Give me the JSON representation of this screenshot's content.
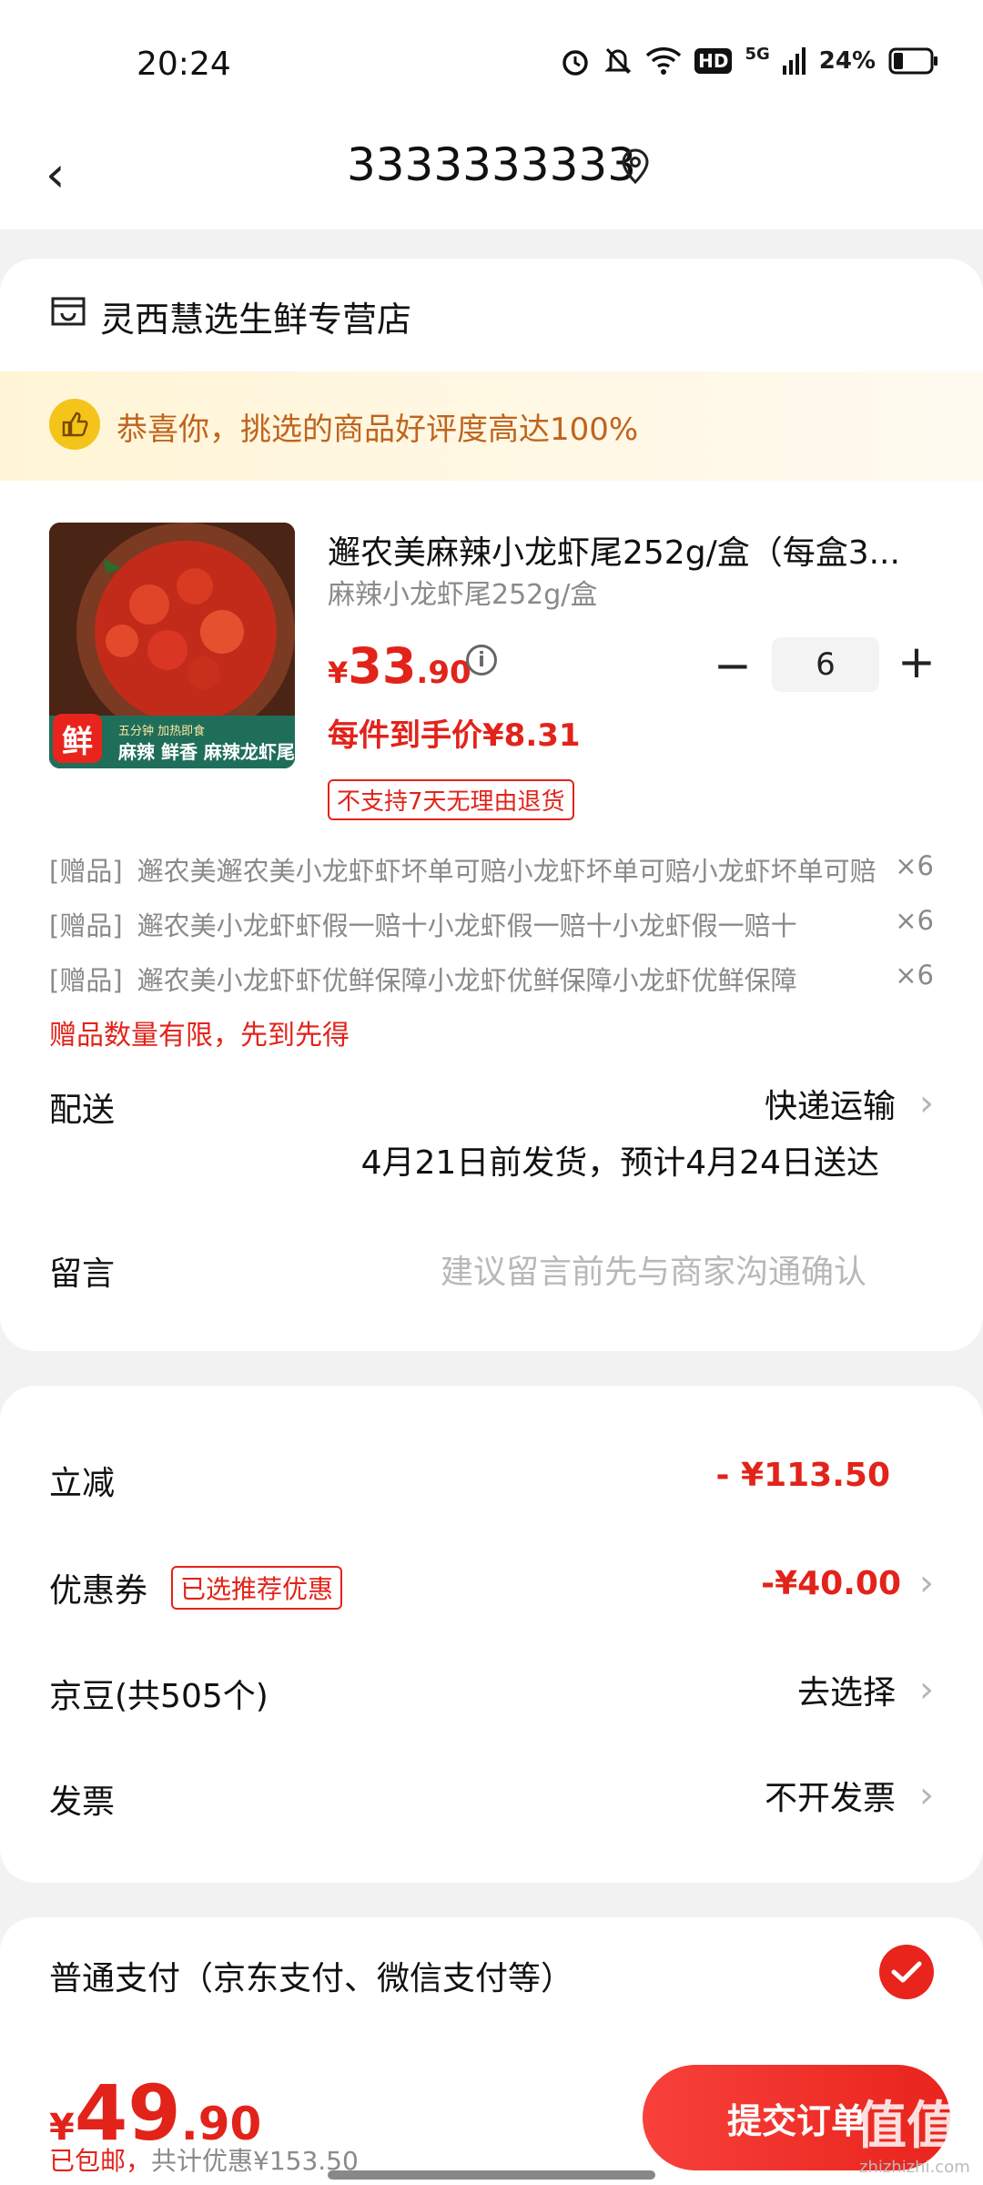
{
  "status_bar": {
    "time": "20:24",
    "network": "5G",
    "battery": "24%",
    "hd": "HD"
  },
  "header": {
    "title": "3333333333"
  },
  "store": {
    "name": "灵西慧选生鲜专营店",
    "praise_banner": "恭喜你，挑选的商品好评度高达100%"
  },
  "product": {
    "name": "邂农美麻辣小龙虾尾252g/盒（每盒3...",
    "spec": "麻辣小龙虾尾252g/盒",
    "price_symbol": "¥",
    "price_int": "33",
    "price_dec": ".90",
    "quantity": "6",
    "unit_price": "每件到手价¥8.31",
    "return_tag": "不支持7天无理由退货",
    "image_badge": "鲜",
    "image_caption": "麻辣 鲜香  麻辣龙虾尾",
    "image_subcaption": "五分钟 加热即食"
  },
  "gifts": [
    {
      "tag": "[赠品]",
      "name": "邂农美邂农美小龙虾虾坏单可赔小龙虾坏单可赔小龙虾坏单可赔",
      "qty": "×6"
    },
    {
      "tag": "[赠品]",
      "name": "邂农美小龙虾虾假一赔十小龙虾假一赔十小龙虾假一赔十",
      "qty": "×6"
    },
    {
      "tag": "[赠品]",
      "name": "邂农美小龙虾虾优鲜保障小龙虾优鲜保障小龙虾优鲜保障",
      "qty": "×6"
    }
  ],
  "gift_limit": "赠品数量有限，先到先得",
  "delivery": {
    "label": "配送",
    "method": "快递运输",
    "schedule": "4月21日前发货，预计4月24日送达"
  },
  "message": {
    "label": "留言",
    "placeholder": "建议留言前先与商家沟通确认"
  },
  "discounts": {
    "instant_label": "立减",
    "instant_value": "- ¥113.50",
    "coupon_label": "优惠券",
    "coupon_tag": "已选推荐优惠",
    "coupon_value": "-¥40.00",
    "jingdou_label": "京豆(共505个)",
    "jingdou_value": "去选择",
    "invoice_label": "发票",
    "invoice_value": "不开发票"
  },
  "payment": {
    "label": "普通支付（京东支付、微信支付等）"
  },
  "footer": {
    "total_symbol": "¥",
    "total_int": "49",
    "total_dec": ".90",
    "free_shipping": "已包邮，",
    "savings": "共计优惠¥153.50",
    "submit": "提交订单"
  },
  "watermark": {
    "logo": "值值值",
    "site": "zhizhizhi.com"
  },
  "colors": {
    "accent": "#e2231a",
    "banner_text": "#c0641e"
  }
}
